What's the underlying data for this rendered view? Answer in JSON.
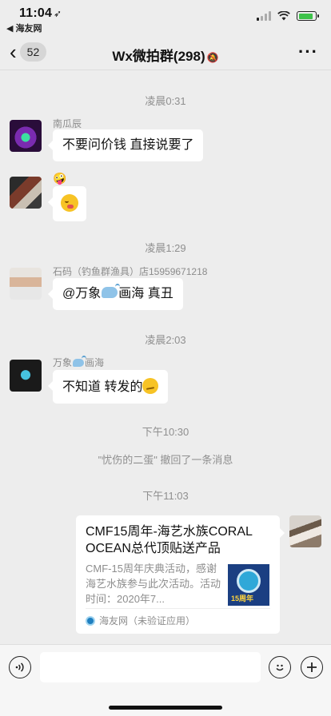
{
  "status": {
    "time": "11:04",
    "location_glyph": "➶",
    "back_app": "◀ 海友网"
  },
  "nav": {
    "back_count": "52",
    "title": "Wx微拍群(298)"
  },
  "messages": {
    "t1": "凌晨0:31",
    "m1_sender": "南瓜辰",
    "m1_text": "不要问价钱 直接说要了",
    "m2_sender_emoji": "🤪",
    "t2": "凌晨1:29",
    "m3_sender": "石码（钓鱼群渔具）店15959671218",
    "m3_prefix": "@万象",
    "m3_suffix": "画海 真丑",
    "t3": "凌晨2:03",
    "m4_sender_prefix": "万象",
    "m4_sender_suffix": "画海",
    "m4_text": "不知道 转发的",
    "t4": "下午10:30",
    "system": "\"忧伤的二蛋\" 撤回了一条消息",
    "t5": "下午11:03"
  },
  "link_card": {
    "title": "CMF15周年-海艺水族CORAL OCEAN总代顶贴送产品",
    "desc": "CMF-15周年庆典活动，感谢海艺水族参与此次活动。活动时间：2020年7...",
    "thumb_text": "15周年",
    "source": "海友网（未验证应用）"
  },
  "input": {
    "placeholder": ""
  },
  "colors": {
    "background": "#ededed",
    "bubble": "#ffffff",
    "battery": "#3ec24a"
  },
  "battery_level": 0.85
}
